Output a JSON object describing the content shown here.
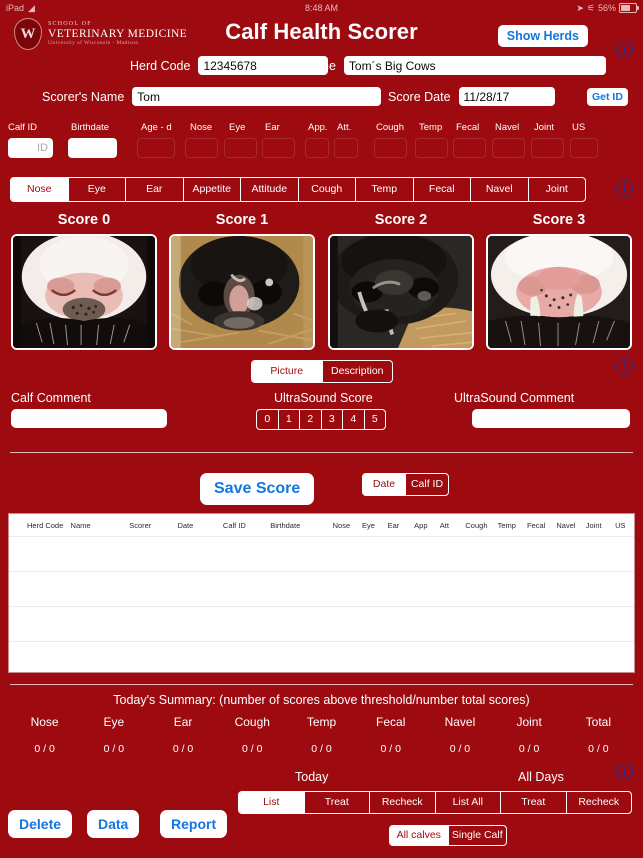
{
  "status_bar": {
    "device": "iPad",
    "wifi_icon": "wifi-icon",
    "time": "8:48 AM",
    "location_icon": "location-arrow-icon",
    "bluetooth_icon": "bluetooth-icon",
    "battery_percent": "56%",
    "battery_icon": "battery-icon"
  },
  "header": {
    "logo": {
      "crest_letter": "W",
      "line1": "SCHOOL OF",
      "line2": "VETERINARY MEDICINE",
      "line3": "University of Wisconsin - Madison"
    },
    "title": "Calf Health Scorer",
    "show_herds_label": "Show Herds",
    "info_icon": "info-icon"
  },
  "form": {
    "herd_code_label": "Herd Code",
    "herd_code_value": "12345678",
    "herd_name_label": "Herd Name",
    "herd_name_value": "Tom´s Big Cows",
    "scorer_name_label": "Scorer's Name",
    "scorer_name_value": "Tom",
    "score_date_label": "Score Date",
    "score_date_value": "11/28/17",
    "get_id_label": "Get ID"
  },
  "calf_row": {
    "columns": [
      "Calf ID",
      "Birthdate",
      "Age - d",
      "Nose",
      "Eye",
      "Ear",
      "App.",
      "Att.",
      "Cough",
      "Temp",
      "Fecal",
      "Navel",
      "Joint",
      "US"
    ],
    "calf_id_placeholder": "ID",
    "calf_id_value": "",
    "birthdate_value": ""
  },
  "category_tabs": {
    "items": [
      "Nose",
      "Eye",
      "Ear",
      "Appetite",
      "Attitude",
      "Cough",
      "Temp",
      "Fecal",
      "Navel",
      "Joint"
    ],
    "selected": "Nose"
  },
  "scores": {
    "cards": [
      {
        "label": "Score 0",
        "image_name": "calf-nose-score-0-photo"
      },
      {
        "label": "Score 1",
        "image_name": "calf-nose-score-1-photo"
      },
      {
        "label": "Score 2",
        "image_name": "calf-nose-score-2-photo"
      },
      {
        "label": "Score 3",
        "image_name": "calf-nose-score-3-photo"
      }
    ]
  },
  "view_mode": {
    "items": [
      "Picture",
      "Description"
    ],
    "selected": "Picture"
  },
  "comments": {
    "calf_comment_label": "Calf Comment",
    "calf_comment_value": "",
    "ultrasound_score_label": "UltraSound Score",
    "ultrasound_scores": [
      "0",
      "1",
      "2",
      "3",
      "4",
      "5"
    ],
    "ultrasound_selected": "",
    "ultrasound_comment_label": "UltraSound Comment",
    "ultrasound_comment_value": ""
  },
  "save": {
    "save_label": "Save Score",
    "sort_items": [
      "Date",
      "Calf ID"
    ],
    "sort_selected": "Date"
  },
  "table": {
    "columns": [
      "Herd Code",
      "Name",
      "Scorer",
      "Date",
      "Calf ID",
      "Birthdate",
      "Nose",
      "Eye",
      "Ear",
      "App",
      "Att",
      "Cough",
      "Temp",
      "Fecal",
      "Navel",
      "Joint",
      "US"
    ],
    "rows": []
  },
  "summary": {
    "title": "Today's Summary: (number of scores above threshold/number total scores)",
    "headers": [
      "Nose",
      "Eye",
      "Ear",
      "Cough",
      "Temp",
      "Fecal",
      "Navel",
      "Joint",
      "Total"
    ],
    "values": [
      "0 / 0",
      "0 / 0",
      "0 / 0",
      "0 / 0",
      "0 / 0",
      "0 / 0",
      "0 / 0",
      "0 / 0",
      "0 / 0"
    ]
  },
  "bottom": {
    "delete_label": "Delete",
    "data_label": "Data",
    "report_label": "Report",
    "today_label": "Today",
    "all_days_label": "All Days",
    "list_items": [
      "List",
      "Treat",
      "Recheck",
      "List All",
      "Treat",
      "Recheck"
    ],
    "list_selected": "List",
    "calves_items": [
      "All calves",
      "Single Calf"
    ],
    "calves_selected": "All calves",
    "info_icon": "info-icon"
  },
  "colors": {
    "background": "#9d0b10",
    "accent_blue": "#1277e0",
    "info_blue": "#2b2f8f",
    "white": "#ffffff"
  }
}
